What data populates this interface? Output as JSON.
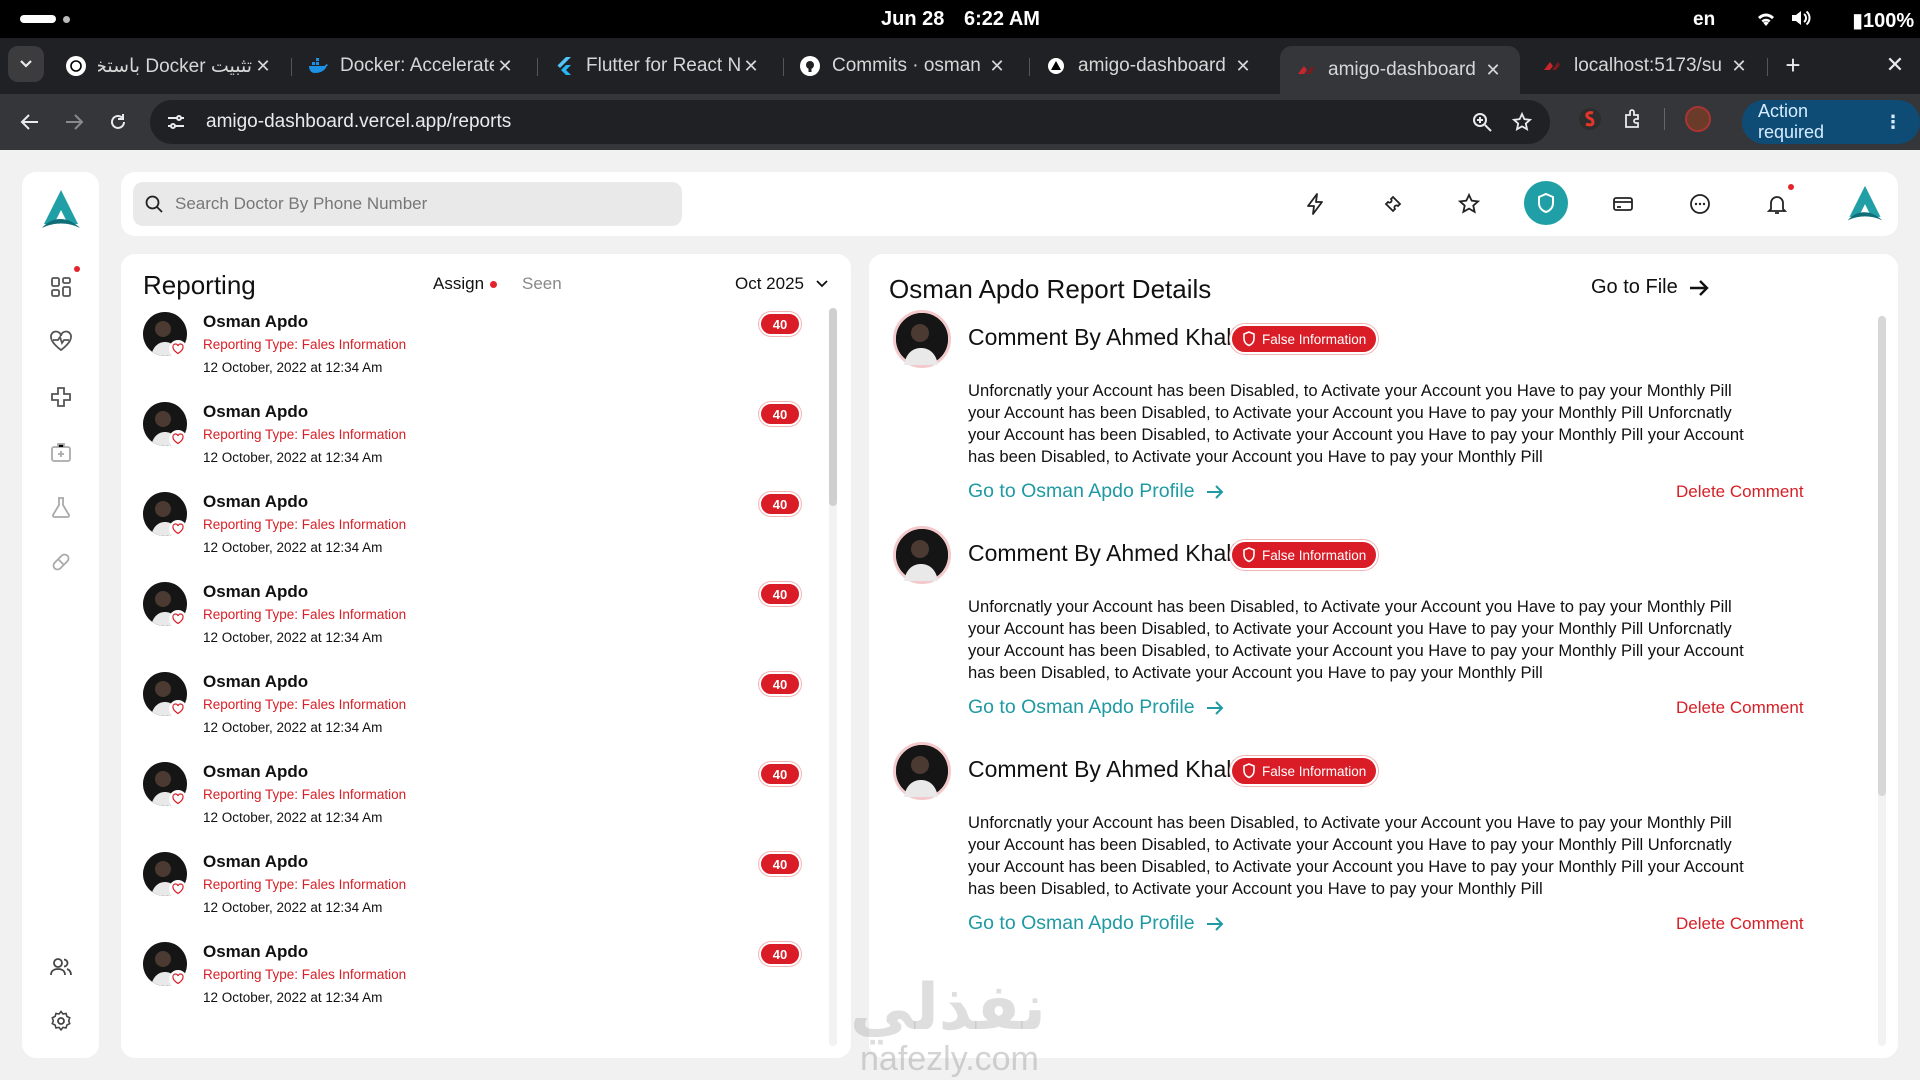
{
  "status_bar": {
    "date": "Jun 28",
    "time": "6:22 AM",
    "lang": "en",
    "battery": "100%"
  },
  "tabs": [
    {
      "title": "تثبيت Docker باستخدام",
      "icon": "openai-icon",
      "active": false
    },
    {
      "title": "Docker: Accelerated",
      "icon": "docker-icon",
      "active": false
    },
    {
      "title": "Flutter for React Native",
      "icon": "flutter-icon",
      "active": false
    },
    {
      "title": "Commits · osman",
      "icon": "github-icon",
      "active": false
    },
    {
      "title": "amigo-dashboard",
      "icon": "vercel-icon",
      "active": false
    },
    {
      "title": "amigo-dashboard",
      "icon": "app-icon",
      "active": true
    },
    {
      "title": "localhost:5173/su",
      "icon": "app-icon",
      "active": false
    }
  ],
  "toolbar": {
    "url": "amigo-dashboard.vercel.app/reports",
    "action_required": "Action required"
  },
  "topbar": {
    "search_placeholder": "Search Doctor By Phone Number"
  },
  "reporting": {
    "title": "Reporting",
    "tab_assign": "Assign",
    "tab_seen": "Seen",
    "month": "Oct 2025",
    "items": [
      {
        "name": "Osman Apdo",
        "type": "Reporting Type: Fales Information",
        "date": "12 October, 2022 at 12:34 Am",
        "count": "40"
      },
      {
        "name": "Osman Apdo",
        "type": "Reporting Type: Fales Information",
        "date": "12 October, 2022 at 12:34 Am",
        "count": "40"
      },
      {
        "name": "Osman Apdo",
        "type": "Reporting Type: Fales Information",
        "date": "12 October, 2022 at 12:34 Am",
        "count": "40"
      },
      {
        "name": "Osman Apdo",
        "type": "Reporting Type: Fales Information",
        "date": "12 October, 2022 at 12:34 Am",
        "count": "40"
      },
      {
        "name": "Osman Apdo",
        "type": "Reporting Type: Fales Information",
        "date": "12 October, 2022 at 12:34 Am",
        "count": "40"
      },
      {
        "name": "Osman Apdo",
        "type": "Reporting Type: Fales Information",
        "date": "12 October, 2022 at 12:34 Am",
        "count": "40"
      },
      {
        "name": "Osman Apdo",
        "type": "Reporting Type: Fales Information",
        "date": "12 October, 2022 at 12:34 Am",
        "count": "40"
      },
      {
        "name": "Osman Apdo",
        "type": "Reporting Type: Fales Information",
        "date": "12 October, 2022 at 12:34 Am",
        "count": "40"
      }
    ]
  },
  "details": {
    "title": "Osman Apdo Report Details",
    "go_to_file": "Go to File",
    "comments": [
      {
        "title": "Comment By Ahmed Khalid",
        "badge": "False Information",
        "text": "Unforcnatly your Account has been Disabled, to Activate your Account you Have to pay your Monthly Pill your Account has been Disabled, to Activate your Account you Have to pay your Monthly Pill Unforcnatly your Account has been Disabled, to Activate your Account you Have to pay your Monthly Pill your Account has been Disabled, to Activate your Account you Have to pay your Monthly Pill",
        "profile_link": "Go to Osman Apdo Profile",
        "delete": "Delete Comment"
      },
      {
        "title": "Comment By Ahmed Khalid",
        "badge": "False Information",
        "text": "Unforcnatly your Account has been Disabled, to Activate your Account you Have to pay your Monthly Pill your Account has been Disabled, to Activate your Account you Have to pay your Monthly Pill Unforcnatly your Account has been Disabled, to Activate your Account you Have to pay your Monthly Pill your Account has been Disabled, to Activate your Account you Have to pay your Monthly Pill",
        "profile_link": "Go to Osman Apdo Profile",
        "delete": "Delete Comment"
      },
      {
        "title": "Comment By Ahmed Khalid",
        "badge": "False Information",
        "text": "Unforcnatly your Account has been Disabled, to Activate your Account you Have to pay your Monthly Pill your Account has been Disabled, to Activate your Account you Have to pay your Monthly Pill Unforcnatly your Account has been Disabled, to Activate your Account you Have to pay your Monthly Pill your Account has been Disabled, to Activate your Account you Have to pay your Monthly Pill",
        "profile_link": "Go to Osman Apdo Profile",
        "delete": "Delete Comment"
      }
    ]
  },
  "watermark": {
    "arabic": "نفذلي",
    "latin": "nafezly.com"
  },
  "colors": {
    "accent_teal": "#20a0a6",
    "alert_red": "#d91c25",
    "link_teal": "#1f9aa2"
  }
}
